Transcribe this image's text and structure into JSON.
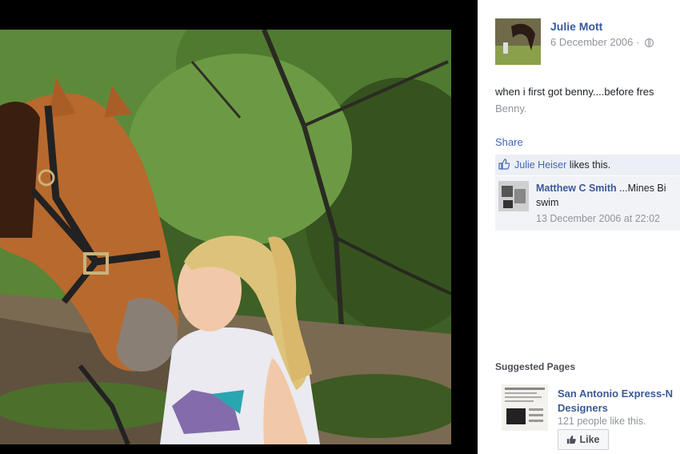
{
  "post": {
    "author": "Julie Mott",
    "date": "6 December 2006 ·",
    "audience_icon": "globe-icon",
    "caption": "when i first got benny....before fres",
    "caption_link": "Benny.",
    "share_label": "Share"
  },
  "likes": {
    "liker": "Julie Heiser",
    "suffix": " likes this."
  },
  "comment": {
    "author": "Matthew C Smith",
    "text": " ...Mines Bi",
    "text_line2": "swim",
    "date": "13 December 2006 at 22:02"
  },
  "suggested": {
    "title": "Suggested Pages",
    "page_name_line1": "San Antonio Express-N",
    "page_name_line2": "Designers",
    "like_count": "121 people like this.",
    "like_button": "Like"
  },
  "colors": {
    "link_blue": "#3b5998",
    "share_blue": "#4267b2",
    "muted_gray": "#90949c",
    "stage_black": "#000000"
  }
}
